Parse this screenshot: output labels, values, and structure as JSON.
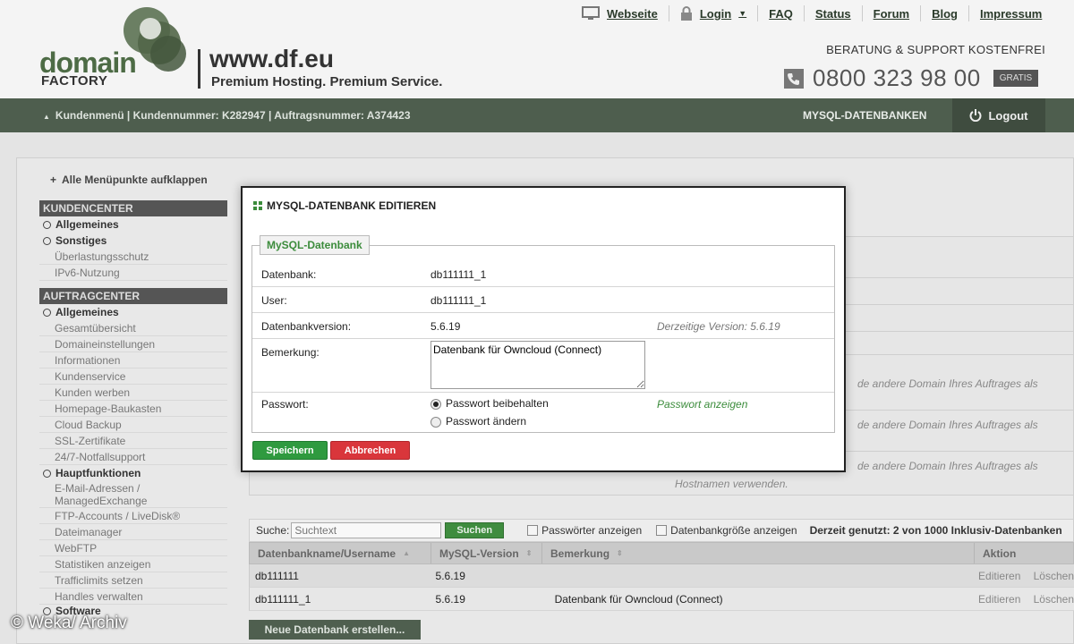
{
  "header": {
    "logo_word": "domain",
    "logo_sub": "FACTORY",
    "site_url": "www.df.eu",
    "tagline": "Premium Hosting. Premium Service.",
    "nav": [
      {
        "label": "Webseite",
        "icon": "monitor-icon"
      },
      {
        "label": "Login",
        "icon": "lock-icon"
      },
      {
        "label": "FAQ"
      },
      {
        "label": "Status"
      },
      {
        "label": "Forum"
      },
      {
        "label": "Blog"
      },
      {
        "label": "Impressum"
      }
    ],
    "support": "BERATUNG & SUPPORT KOSTENFREI",
    "phone": "0800 323 98 00",
    "gratis": "GRATIS"
  },
  "menubar": {
    "left": "Kundenmenü | Kundennummer: K282947 | Auftragsnummer: A374423",
    "section": "MYSQL-DATENBANKEN",
    "logout": "Logout"
  },
  "sidebar": {
    "expand": "Alle Menüpunkte aufklappen",
    "kundencenter": "KUNDENCENTER",
    "kc_groups": [
      "Allgemeines",
      "Sonstiges"
    ],
    "kc_items": [
      "Überlastungsschutz",
      "IPv6-Nutzung"
    ],
    "auftragcenter": "AUFTRAGCENTER",
    "ac_group1": "Allgemeines",
    "ac_items1": [
      "Gesamtübersicht",
      "Domaineinstellungen",
      "Informationen",
      "Kundenservice",
      "Kunden werben",
      "Homepage-Baukasten",
      "Cloud Backup",
      "SSL-Zertifikate",
      "24/7-Notfallsupport"
    ],
    "ac_group2": "Hauptfunktionen",
    "ac_items2": [
      "E-Mail-Adressen / ManagedExchange",
      "FTP-Accounts / LiveDisk®",
      "Dateimanager",
      "WebFTP",
      "Statistiken anzeigen",
      "Trafficlimits setzen",
      "Handles verwalten"
    ],
    "ac_group3": "Software"
  },
  "background": {
    "line1": "de andere Domain Ihres Auftrages als",
    "line2": "de andere Domain Ihres Auftrages als",
    "line3": "de andere Domain Ihres Auftrages als",
    "line4": "Hostnamen verwenden."
  },
  "search": {
    "label": "Suche:",
    "placeholder": "Suchtext",
    "button": "Suchen",
    "check1": "Passwörter anzeigen",
    "check2": "Datenbankgröße anzeigen",
    "usage": "Derzeit genutzt: 2 von 1000 Inklusiv-Datenbanken"
  },
  "table": {
    "headers": [
      "Datenbankname/Username",
      "MySQL-Version",
      "Bemerkung",
      "Aktion"
    ],
    "rows": [
      {
        "name": "db111111",
        "version": "5.6.19",
        "note": "",
        "edit": "Editieren",
        "delete": "Löschen"
      },
      {
        "name": "db111111_1",
        "version": "5.6.19",
        "note": "Datenbank für Owncloud (Connect)",
        "edit": "Editieren",
        "delete": "Löschen"
      }
    ],
    "new_button": "Neue Datenbank erstellen..."
  },
  "watermark": "© Weka/ Archiv",
  "modal": {
    "title": "MYSQL-DATENBANK EDITIEREN",
    "legend": "MySQL-Datenbank",
    "datenbank_label": "Datenbank:",
    "datenbank_value": "db111111_1",
    "user_label": "User:",
    "user_value": "db111111_1",
    "version_label": "Datenbankversion:",
    "version_value": "5.6.19",
    "version_hint": "Derzeitige Version: 5.6.19",
    "bemerkung_label": "Bemerkung:",
    "bemerkung_value": "Datenbank für Owncloud (Connect)",
    "passwort_label": "Passwort:",
    "pw_keep": "Passwort beibehalten",
    "pw_change": "Passwort ändern",
    "pw_show": "Passwort anzeigen",
    "save": "Speichern",
    "cancel": "Abbrechen"
  },
  "colors": {
    "menubar": "#4e5e4e",
    "accent_green": "#3c8c3c",
    "save": "#2f9a3f",
    "cancel": "#d9363b"
  }
}
